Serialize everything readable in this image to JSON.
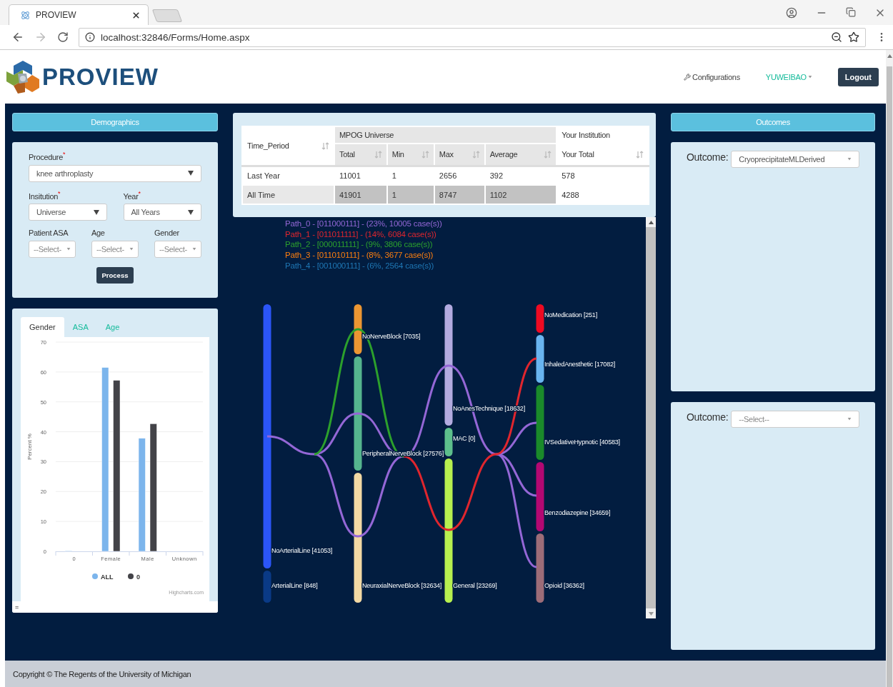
{
  "browser": {
    "tab_title": "PROVIEW",
    "url": "localhost:32846/Forms/Home.aspx"
  },
  "header": {
    "logo_text": "PROVIEW",
    "nav": [
      {
        "label": "Configurations",
        "kind": "link"
      },
      {
        "label": "YUWEIBAO",
        "kind": "user"
      }
    ],
    "logout": "Logout"
  },
  "demographics": {
    "title": "Demographics",
    "rows": [
      [
        {
          "label": "Procedure",
          "mark": "*",
          "value": "knee arthroplasty",
          "kind": "large"
        }
      ],
      [
        {
          "label": "Insitution",
          "mark": "*",
          "value": "Universe",
          "kind": "large"
        },
        {
          "label": "Year",
          "mark": "*",
          "value": "All Years",
          "kind": "large"
        }
      ],
      [
        {
          "label": "Patient ASA",
          "placeholder": "--Select-",
          "kind": "small"
        },
        {
          "label": "Age",
          "placeholder": "--Select-",
          "kind": "small"
        },
        {
          "label": "Gender",
          "placeholder": "--Select-",
          "kind": "small"
        }
      ]
    ],
    "process": "Process"
  },
  "distribution": {
    "tabs": [
      {
        "label": "Gender",
        "selected": true
      },
      {
        "label": "ASA",
        "selected": false
      },
      {
        "label": "Age",
        "selected": false
      }
    ],
    "chart_data": {
      "type": "bar",
      "ylabel": "Percent %",
      "categories": [
        "0",
        "Female",
        "Male",
        "Unknown"
      ],
      "series": [
        {
          "name": "ALL",
          "color": "#7cb5ec",
          "values": [
            0.2,
            61.5,
            37.8,
            0
          ]
        },
        {
          "name": "0",
          "color": "#434348",
          "values": [
            0,
            57.2,
            42.7,
            0
          ]
        }
      ],
      "ylim": [
        0,
        70
      ],
      "yticks": [
        0,
        10,
        20,
        30,
        40,
        50,
        60,
        70
      ],
      "grid": true,
      "legend": "bottom"
    },
    "credits": "Highcharts.com",
    "footer_text": "="
  },
  "summary_table": {
    "groups": [
      {
        "label": "MPOG Universe"
      },
      {
        "label": "Your Institution"
      }
    ],
    "columns": [
      "Time_Period",
      "Total",
      "Min",
      "Max",
      "Average",
      "Your Total"
    ],
    "rows": [
      {
        "cells": [
          "Last Year",
          "11001",
          "1",
          "2656",
          "392",
          "578"
        ],
        "highlighted": false
      },
      {
        "cells": [
          "All Time",
          "41901",
          "1",
          "8747",
          "1102",
          "4288"
        ],
        "highlighted": true
      }
    ]
  },
  "pathways": {
    "legend": [
      {
        "text": "Path_0 - [011000111] - (23%, 10005 case(s))",
        "color": "#9467d6"
      },
      {
        "text": "Path_1 - [011011111] - (14%, 6084 case(s))",
        "color": "#e0262e"
      },
      {
        "text": "Path_2 - [000011111] - (9%, 3806 case(s))",
        "color": "#2ca02c"
      },
      {
        "text": "Path_3 - [011010111] - (8%, 3677 case(s))",
        "color": "#ff7f0e"
      },
      {
        "text": "Path_4 - [001000111] - (6%, 2564 case(s))",
        "color": "#1f77b4"
      }
    ],
    "columns": [
      {
        "nodes": [
          {
            "label": "NoArterialLine [41053]",
            "color": "#2b55f7"
          },
          {
            "label": "ArterialLine [848]",
            "color": "#0a3a86"
          }
        ]
      },
      {
        "nodes": [
          {
            "label": "NoNerveBlock [7035]",
            "color": "#ec9632"
          },
          {
            "label": "PeripheralNerveBlock [27576]",
            "color": "#55b58e"
          },
          {
            "label": "NeuraxialNerveBlock [32634]",
            "color": "#f3d9a4"
          }
        ]
      },
      {
        "nodes": [
          {
            "label": "NoAnesTechnique [18632]",
            "color": "#b3abe0"
          },
          {
            "label": "MAC [0]",
            "color": "#5dbf8c"
          },
          {
            "label": "General [23269]",
            "color": "#b7f04f"
          }
        ]
      },
      {
        "nodes": [
          {
            "label": "NoMedication [251]",
            "color": "#ee0a22"
          },
          {
            "label": "InhaledAnesthetic [17082]",
            "color": "#69b5f0"
          },
          {
            "label": "IVSedativeHypnotic [40583]",
            "color": "#1a8a2a"
          },
          {
            "label": "Benzodiazepine [34659]",
            "color": "#b30872"
          },
          {
            "label": "Opioid [36362]",
            "color": "#9c6c78"
          }
        ]
      }
    ]
  },
  "outcomes": {
    "title": "Outcomes",
    "panels": [
      {
        "label": "Outcome:",
        "value": "CryoprecipitateMLDerived"
      },
      {
        "label": "Outcome:",
        "placeholder": "--Select--"
      }
    ]
  },
  "footer": "Copyright © The Regents of the University of Michigan"
}
